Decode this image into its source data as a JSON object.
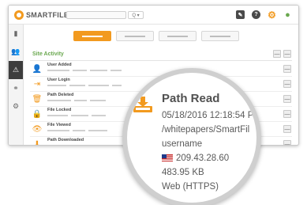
{
  "header": {
    "logo_text": "SMARTFILE",
    "search_button_glyph": "Q ▾",
    "icons": [
      "edit-icon",
      "help-icon",
      "settings-gear-icon",
      "user-icon"
    ]
  },
  "sidebar": {
    "items": [
      {
        "icon": "file-icon",
        "glyph": "▮"
      },
      {
        "icon": "users-icon",
        "glyph": "👥"
      },
      {
        "icon": "warning-icon",
        "glyph": "⚠",
        "active": true
      },
      {
        "icon": "link-icon",
        "glyph": "⚭"
      },
      {
        "icon": "settings-icon",
        "glyph": "⚙"
      }
    ]
  },
  "tabs": {
    "active_index": 0,
    "count": 4
  },
  "section": {
    "title": "Site Activity",
    "collapse_glyph": "—"
  },
  "activity_rows": [
    {
      "label": "User Added",
      "icon": "user-add-icon",
      "glyph": "👤"
    },
    {
      "label": "User Login",
      "icon": "login-icon",
      "glyph": "⇥"
    },
    {
      "label": "Path Deleted",
      "icon": "trash-icon",
      "glyph": "🗑"
    },
    {
      "label": "File Locked",
      "icon": "lock-icon",
      "glyph": "🔒"
    },
    {
      "label": "File Viewed",
      "icon": "eye-icon",
      "glyph": "👁"
    },
    {
      "label": "Path Downloaded",
      "icon": "download-icon",
      "glyph": "⬇"
    }
  ],
  "detail": {
    "title": "Path Read",
    "timestamp": "05/18/2016 12:18:54 P",
    "path": "/whitepapers/SmartFil",
    "user": "username",
    "ip": "209.43.28.60",
    "size": "483.95 KB",
    "protocol": "Web (HTTPS)"
  },
  "colors": {
    "accent": "#f29a1f",
    "section_title": "#6aa84f",
    "sidebar_active": "#3d3d3d"
  }
}
